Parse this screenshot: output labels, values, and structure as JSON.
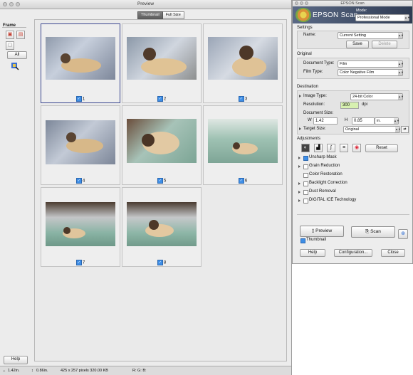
{
  "preview": {
    "title": "Preview",
    "tabs": [
      {
        "label": "Thumbnail",
        "selected": true
      },
      {
        "label": "Full Size",
        "selected": false
      }
    ],
    "frame_label": "Frame",
    "all_button": "All",
    "help_button": "Help",
    "thumbnails": [
      {
        "number": "1",
        "checked": true,
        "selected": true
      },
      {
        "number": "2",
        "checked": true,
        "selected": false
      },
      {
        "number": "3",
        "checked": true,
        "selected": false
      },
      {
        "number": "4",
        "checked": true,
        "selected": false
      },
      {
        "number": "5",
        "checked": true,
        "selected": false
      },
      {
        "number": "6",
        "checked": true,
        "selected": false
      },
      {
        "number": "7",
        "checked": true,
        "selected": false
      },
      {
        "number": "8",
        "checked": true,
        "selected": false
      }
    ],
    "status": {
      "width": "1.42in.",
      "height": "0.86in.",
      "pixels": "425 x 257 pixels 320.00 KB",
      "rgb": "R:  G:  B:"
    }
  },
  "epson": {
    "title": "EPSON Scan",
    "logo_text": "EPSON Scan",
    "mode_label": "Mode:",
    "mode_value": "Professional Mode",
    "settings": {
      "section_label": "Settings",
      "name_label": "Name:",
      "name_value": "Current Setting",
      "save_button": "Save",
      "delete_button": "Delete"
    },
    "original": {
      "section_label": "Original",
      "document_type_label": "Document Type:",
      "document_type_value": "Film",
      "film_type_label": "Film Type:",
      "film_type_value": "Color Negative Film"
    },
    "destination": {
      "section_label": "Destination",
      "image_type_label": "Image Type:",
      "image_type_value": "24-bit Color",
      "resolution_label": "Resolution:",
      "resolution_value": "300",
      "resolution_unit": "dpi",
      "document_size_label": "Document Size:",
      "w_label": "W",
      "w_value": "1.42",
      "h_label": "H",
      "h_value": "0.85",
      "unit_value": "in.",
      "target_size_label": "Target Size:",
      "target_size_value": "Original"
    },
    "adjustments": {
      "section_label": "Adjustments",
      "reset_button": "Reset",
      "items": [
        {
          "label": "Unsharp Mask",
          "checked": true,
          "expandable": true
        },
        {
          "label": "Grain Reduction",
          "checked": false,
          "expandable": true
        },
        {
          "label": "Color Restoration",
          "checked": false,
          "expandable": false
        },
        {
          "label": "Backlight Correction",
          "checked": false,
          "expandable": true
        },
        {
          "label": "Dust Removal",
          "checked": false,
          "expandable": true
        },
        {
          "label": "DIGITAL ICE Technology",
          "checked": false,
          "expandable": true
        }
      ]
    },
    "preview_button": "Preview",
    "scan_button": "Scan",
    "thumbnail_label": "Thumbnail",
    "thumbnail_checked": true,
    "help_button": "Help",
    "configuration_button": "Configuration...",
    "close_button": "Close"
  }
}
